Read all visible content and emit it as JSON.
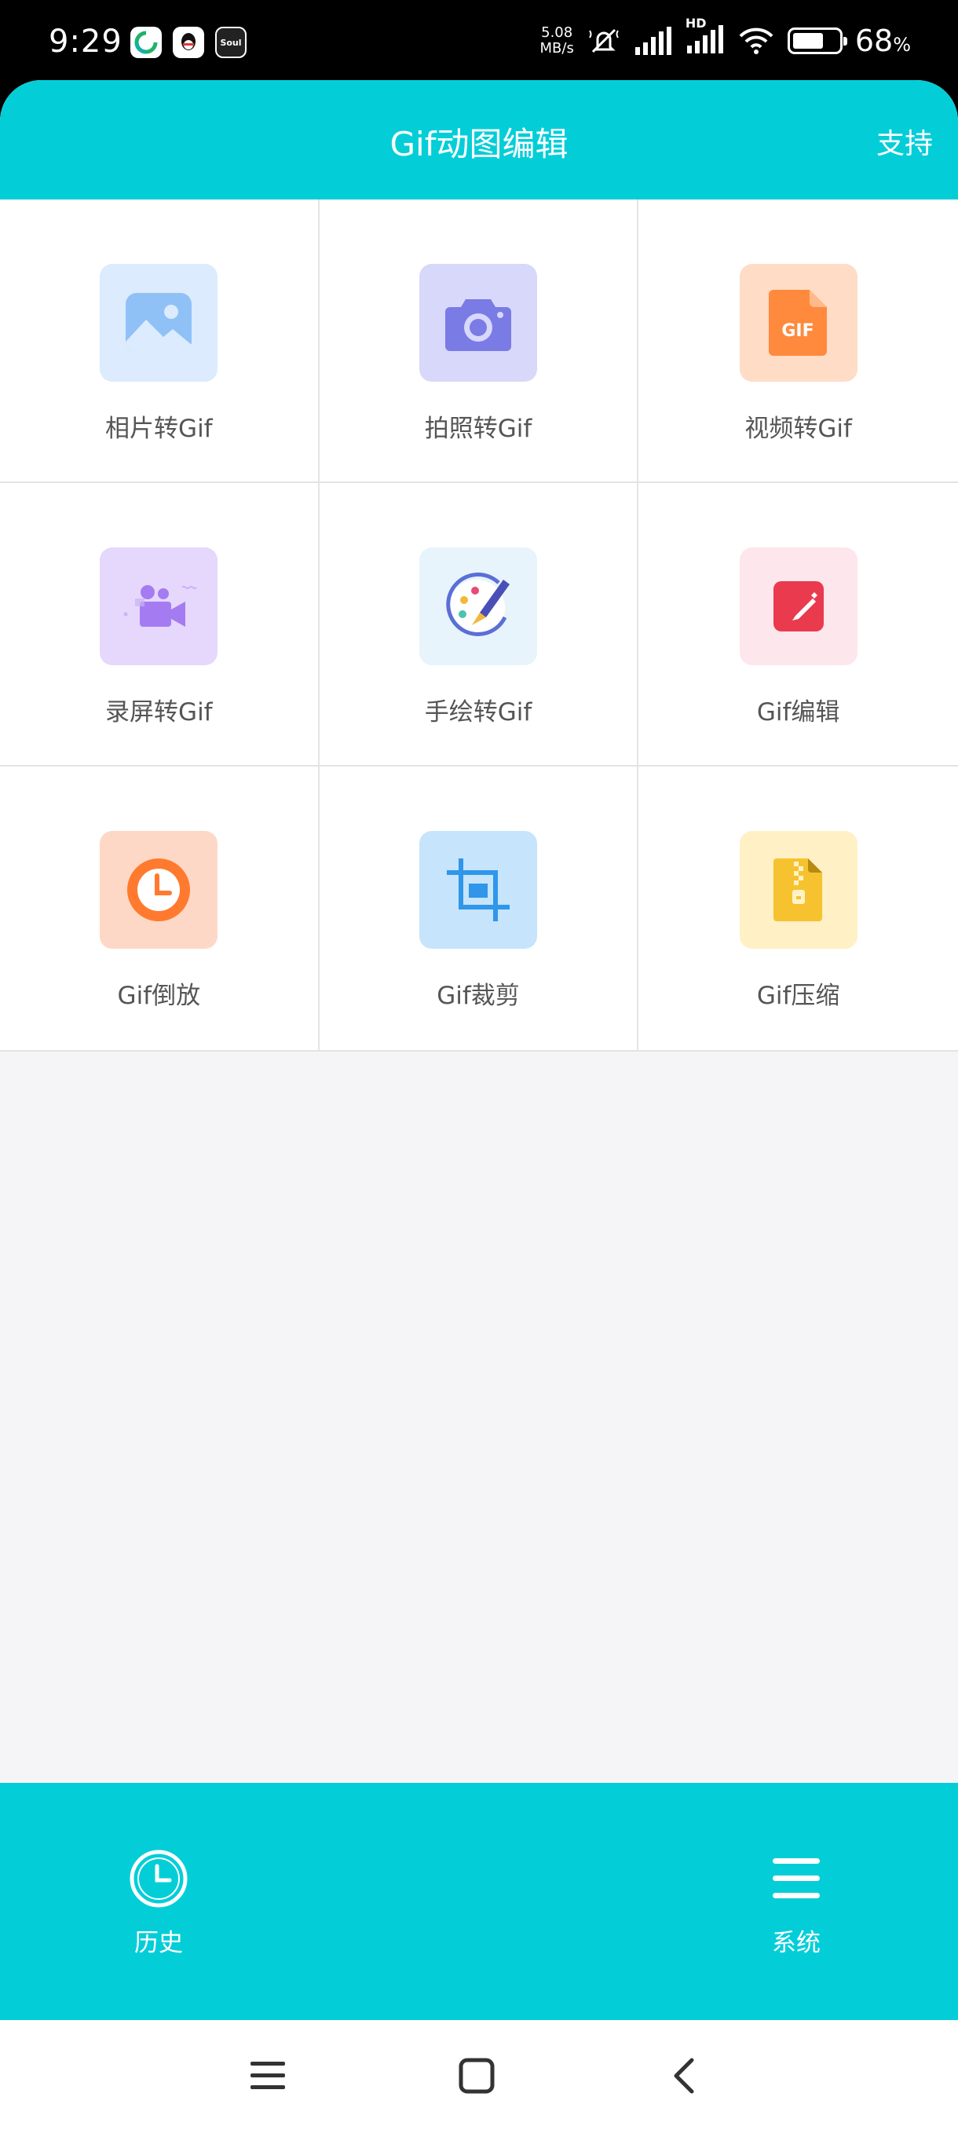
{
  "status_bar": {
    "time": "9:29",
    "network_speed_value": "5.08",
    "network_speed_unit": "MB/s",
    "network_type": "HD",
    "battery_percent": "68",
    "battery_unit": "%",
    "battery_level": 0.68,
    "notification_apps": [
      "green-app-icon",
      "qq-icon",
      "soul-app-icon"
    ],
    "soul_label": "Soul"
  },
  "header": {
    "title": "Gif动图编辑",
    "support_label": "支持"
  },
  "tools": [
    {
      "label": "相片转Gif",
      "icon": "photo-icon",
      "tile_color": "#dcebfd",
      "icon_color": "#8fc1f7"
    },
    {
      "label": "拍照转Gif",
      "icon": "camera-icon",
      "tile_color": "#d8d8fb",
      "icon_color": "#7b7be6"
    },
    {
      "label": "视频转Gif",
      "icon": "gif-file-icon",
      "tile_color": "#ffdcc6",
      "icon_color": "#ff8a3d"
    },
    {
      "label": "录屏转Gif",
      "icon": "screen-record-icon",
      "tile_color": "#e5d8fc",
      "icon_color": "#a57bf2"
    },
    {
      "label": "手绘转Gif",
      "icon": "paint-palette-icon",
      "tile_color": "#e7f4fc",
      "icon_color": "#5b6fd6"
    },
    {
      "label": "Gif编辑",
      "icon": "edit-icon",
      "tile_color": "#fde7ec",
      "icon_color": "#ea3a4e"
    },
    {
      "label": "Gif倒放",
      "icon": "clock-icon",
      "tile_color": "#fed8c6",
      "icon_color": "#ff7a2f"
    },
    {
      "label": "Gif裁剪",
      "icon": "crop-icon",
      "tile_color": "#c6e4fb",
      "icon_color": "#2f96ea"
    },
    {
      "label": "Gif压缩",
      "icon": "zip-file-icon",
      "tile_color": "#fff0c6",
      "icon_color": "#f7c22f"
    }
  ],
  "bottom_nav": {
    "history_label": "历史",
    "system_label": "系统"
  },
  "colors": {
    "brand": "#03ced8",
    "background": "#f5f5f8",
    "grid_line": "#e3e3e3",
    "label_text": "#555555"
  }
}
